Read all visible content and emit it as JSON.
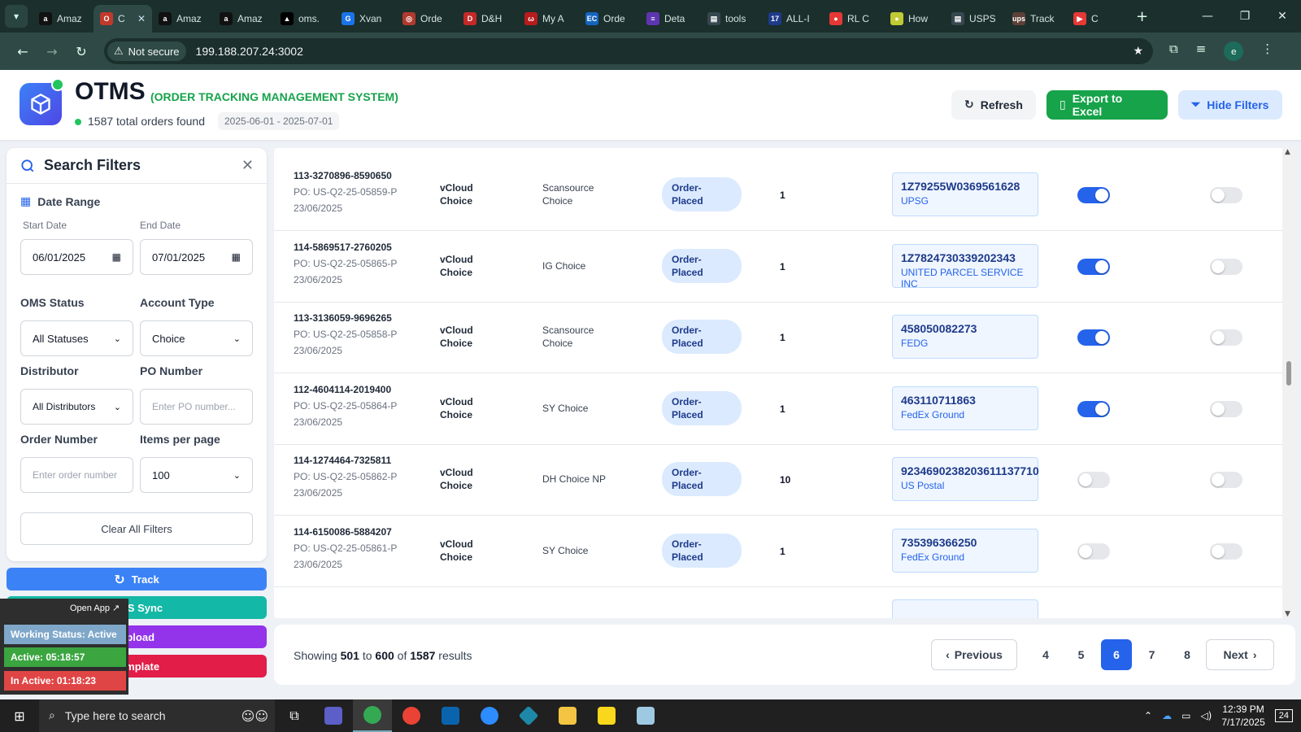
{
  "browser": {
    "tabs": [
      {
        "label": "Amaz",
        "fav": "a",
        "color": "#111111"
      },
      {
        "label": "C",
        "fav": "O",
        "color": "#c0392b",
        "active": true
      },
      {
        "label": "Amaz",
        "fav": "a",
        "color": "#111111"
      },
      {
        "label": "Amaz",
        "fav": "a",
        "color": "#111111"
      },
      {
        "label": "oms.",
        "fav": "▲",
        "color": "#000000"
      },
      {
        "label": "Xvan",
        "fav": "G",
        "color": "#1a73e8"
      },
      {
        "label": "Orde",
        "fav": "◎",
        "color": "#b03a2e"
      },
      {
        "label": "D&H",
        "fav": "D",
        "color": "#c62828"
      },
      {
        "label": "My A",
        "fav": "ω",
        "color": "#b71c1c"
      },
      {
        "label": "Orde",
        "fav": "EC",
        "color": "#1565c0"
      },
      {
        "label": "Deta",
        "fav": "≡",
        "color": "#5e35b1"
      },
      {
        "label": "tools",
        "fav": "▤",
        "color": "#37474f"
      },
      {
        "label": "ALL-I",
        "fav": "17",
        "color": "#1e3a8a"
      },
      {
        "label": "RL C",
        "fav": "●",
        "color": "#e53935"
      },
      {
        "label": "How",
        "fav": "●",
        "color": "#c0ca33"
      },
      {
        "label": "USPS",
        "fav": "▤",
        "color": "#37474f"
      },
      {
        "label": "Track",
        "fav": "ups",
        "color": "#5d4037"
      },
      {
        "label": "C",
        "fav": "▶",
        "color": "#e53935"
      }
    ],
    "new_tab": "+",
    "win_min": "—",
    "win_max": "❐",
    "win_close": "✕",
    "security": "Not secure",
    "url": "199.188.207.24:3002",
    "profile": "e"
  },
  "header": {
    "title": "OTMS",
    "subtitle": "(ORDER TRACKING MANAGEMENT SYSTEM)",
    "total_orders": "1587 total orders found",
    "date_range": "2025-06-01 - 2025-07-01",
    "refresh": "Refresh",
    "export": "Export to Excel",
    "hide_filters": "Hide Filters"
  },
  "filters": {
    "title": "Search Filters",
    "date_range_label": "Date Range",
    "start_label": "Start Date",
    "start_value": "06/01/2025",
    "end_label": "End Date",
    "end_value": "07/01/2025",
    "oms_status_label": "OMS Status",
    "oms_status_value": "All Statuses",
    "account_type_label": "Account Type",
    "account_type_value": "Choice",
    "distributor_label": "Distributor",
    "distributor_value": "All Distributors",
    "po_label": "PO Number",
    "po_placeholder": "Enter PO number...",
    "order_label": "Order Number",
    "order_placeholder": "Enter order number",
    "items_label": "Items per page",
    "items_value": "100",
    "clear": "Clear All Filters"
  },
  "actions": {
    "track": "Track",
    "oms_sync": "OMS Sync",
    "upload": "Upload",
    "template": "Template"
  },
  "widget": {
    "open_app": "Open App ↗",
    "working": "Working Status: Active",
    "active": "Active: 05:18:57",
    "inactive": "In Active: 01:18:23"
  },
  "orders": [
    {
      "order": "113-3270896-8590650",
      "po": "PO: US-Q2-25-05859-P",
      "date": "23/06/2025",
      "account": "vCloud Choice",
      "distributor": "Scansource Choice",
      "status": "Order-Placed",
      "qty": "1",
      "tracking": "1Z79255W0369561628",
      "carrier": "UPSG",
      "toggle1": true,
      "toggle2": false
    },
    {
      "order": "114-5869517-2760205",
      "po": "PO: US-Q2-25-05865-P",
      "date": "23/06/2025",
      "account": "vCloud Choice",
      "distributor": "IG Choice",
      "status": "Order-Placed",
      "qty": "1",
      "tracking": "1Z7824730339202343",
      "carrier": "UNITED PARCEL SERVICE INC",
      "toggle1": true,
      "toggle2": false
    },
    {
      "order": "113-3136059-9696265",
      "po": "PO: US-Q2-25-05858-P",
      "date": "23/06/2025",
      "account": "vCloud Choice",
      "distributor": "Scansource Choice",
      "status": "Order-Placed",
      "qty": "1",
      "tracking": "458050082273",
      "carrier": "FEDG",
      "toggle1": true,
      "toggle2": false
    },
    {
      "order": "112-4604114-2019400",
      "po": "PO: US-Q2-25-05864-P",
      "date": "23/06/2025",
      "account": "vCloud Choice",
      "distributor": "SY Choice",
      "status": "Order-Placed",
      "qty": "1",
      "tracking": "463110711863",
      "carrier": "FedEx Ground",
      "toggle1": true,
      "toggle2": false
    },
    {
      "order": "114-1274464-7325811",
      "po": "PO: US-Q2-25-05862-P",
      "date": "23/06/2025",
      "account": "vCloud Choice",
      "distributor": "DH Choice NP",
      "status": "Order-Placed",
      "qty": "10",
      "tracking": "9234690238203611137710",
      "carrier": "US Postal",
      "toggle1": false,
      "toggle2": false
    },
    {
      "order": "114-6150086-5884207",
      "po": "PO: US-Q2-25-05861-P",
      "date": "23/06/2025",
      "account": "vCloud Choice",
      "distributor": "SY Choice",
      "status": "Order-Placed",
      "qty": "1",
      "tracking": "735396366250",
      "carrier": "FedEx Ground",
      "toggle1": false,
      "toggle2": false
    }
  ],
  "pagination": {
    "showing_prefix": "Showing",
    "from": "501",
    "to_word": "to",
    "to": "600",
    "of_word": "of",
    "total": "1587",
    "suffix": "results",
    "previous": "Previous",
    "pages": [
      "4",
      "5",
      "6",
      "7",
      "8"
    ],
    "current": "6",
    "next": "Next"
  },
  "taskbar": {
    "search": "Type here to search",
    "time": "12:39 PM",
    "date": "7/17/2025",
    "notif": "24"
  },
  "colors": {
    "primary": "#2563eb",
    "success": "#16a34a",
    "status_pill": "#dbeafe"
  }
}
